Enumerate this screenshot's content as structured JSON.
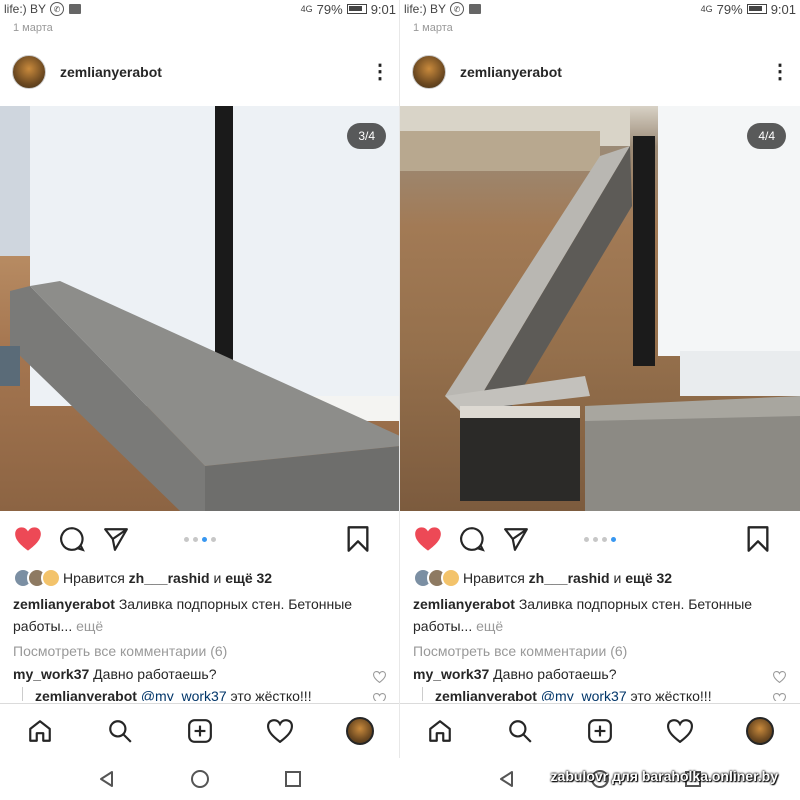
{
  "panels": [
    {
      "status": {
        "carrier": "life:) BY",
        "signal": "4G",
        "battery": "79%",
        "time": "9:01"
      },
      "date": "1 марта",
      "username": "zemlianyerabot",
      "counter": "3/4",
      "liked_by_prefix": "Нравится ",
      "liked_by_user": "zh___rashid",
      "liked_by_mid": " и ",
      "liked_by_rest": "ещё 32",
      "caption_user": "zemlianyerabot",
      "caption_text": " Заливка подпорных стен. Бетонные работы...",
      "caption_more": " ещё",
      "view_comments": "Посмотреть все комментарии (6)",
      "comment_user": "my_work37",
      "comment_text": " Давно работаешь?",
      "reply_user": "zemlianyerabot",
      "reply_mention": " @my_work37",
      "reply_text": " это жёстко!!!"
    },
    {
      "status": {
        "carrier": "life:) BY",
        "signal": "4G",
        "battery": "79%",
        "time": "9:01"
      },
      "date": "1 марта",
      "username": "zemlianyerabot",
      "counter": "4/4",
      "liked_by_prefix": "Нравится ",
      "liked_by_user": "zh___rashid",
      "liked_by_mid": " и ",
      "liked_by_rest": "ещё 32",
      "caption_user": "zemlianyerabot",
      "caption_text": " Заливка подпорных стен. Бетонные работы...",
      "caption_more": " ещё",
      "view_comments": "Посмотреть все комментарии (6)",
      "comment_user": "my_work37",
      "comment_text": " Давно работаешь?",
      "reply_user": "zemlianyerabot",
      "reply_mention": " @my_work37",
      "reply_text": " это жёстко!!!"
    }
  ],
  "watermark": "zabulovr для baraholka.onliner.by",
  "colors": {
    "like": "#ed4956",
    "dot_active": "#3897f0",
    "text": "#262626",
    "muted": "#999999"
  }
}
